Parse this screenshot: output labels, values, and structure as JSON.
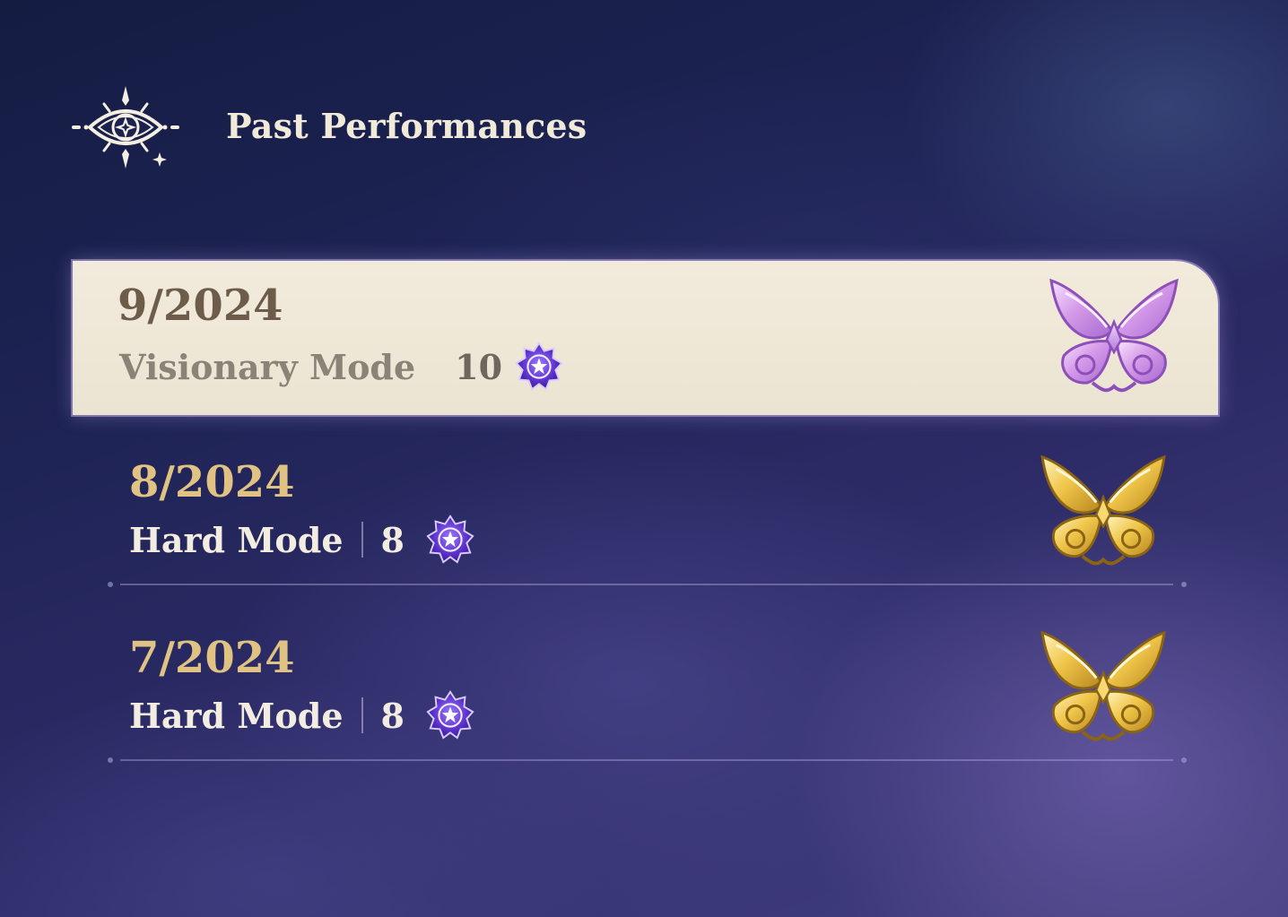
{
  "header": {
    "title": "Past Performances",
    "icon": "eye-sigil-icon"
  },
  "records": [
    {
      "date": "9/2024",
      "mode": "Visionary Mode",
      "stars": "10",
      "selected": true,
      "medal": "lavender-butterfly-medal"
    },
    {
      "date": "8/2024",
      "mode": "Hard Mode",
      "stars": "8",
      "selected": false,
      "medal": "gold-butterfly-medal"
    },
    {
      "date": "7/2024",
      "mode": "Hard Mode",
      "stars": "8",
      "selected": false,
      "medal": "gold-butterfly-medal"
    }
  ],
  "colors": {
    "selected_card": "#f2ebdc",
    "gold_date": "#e0c383",
    "star_purple": "#6b3fd6",
    "medal_gold": "#e7b93d",
    "medal_lavender": "#d9a8e8"
  }
}
